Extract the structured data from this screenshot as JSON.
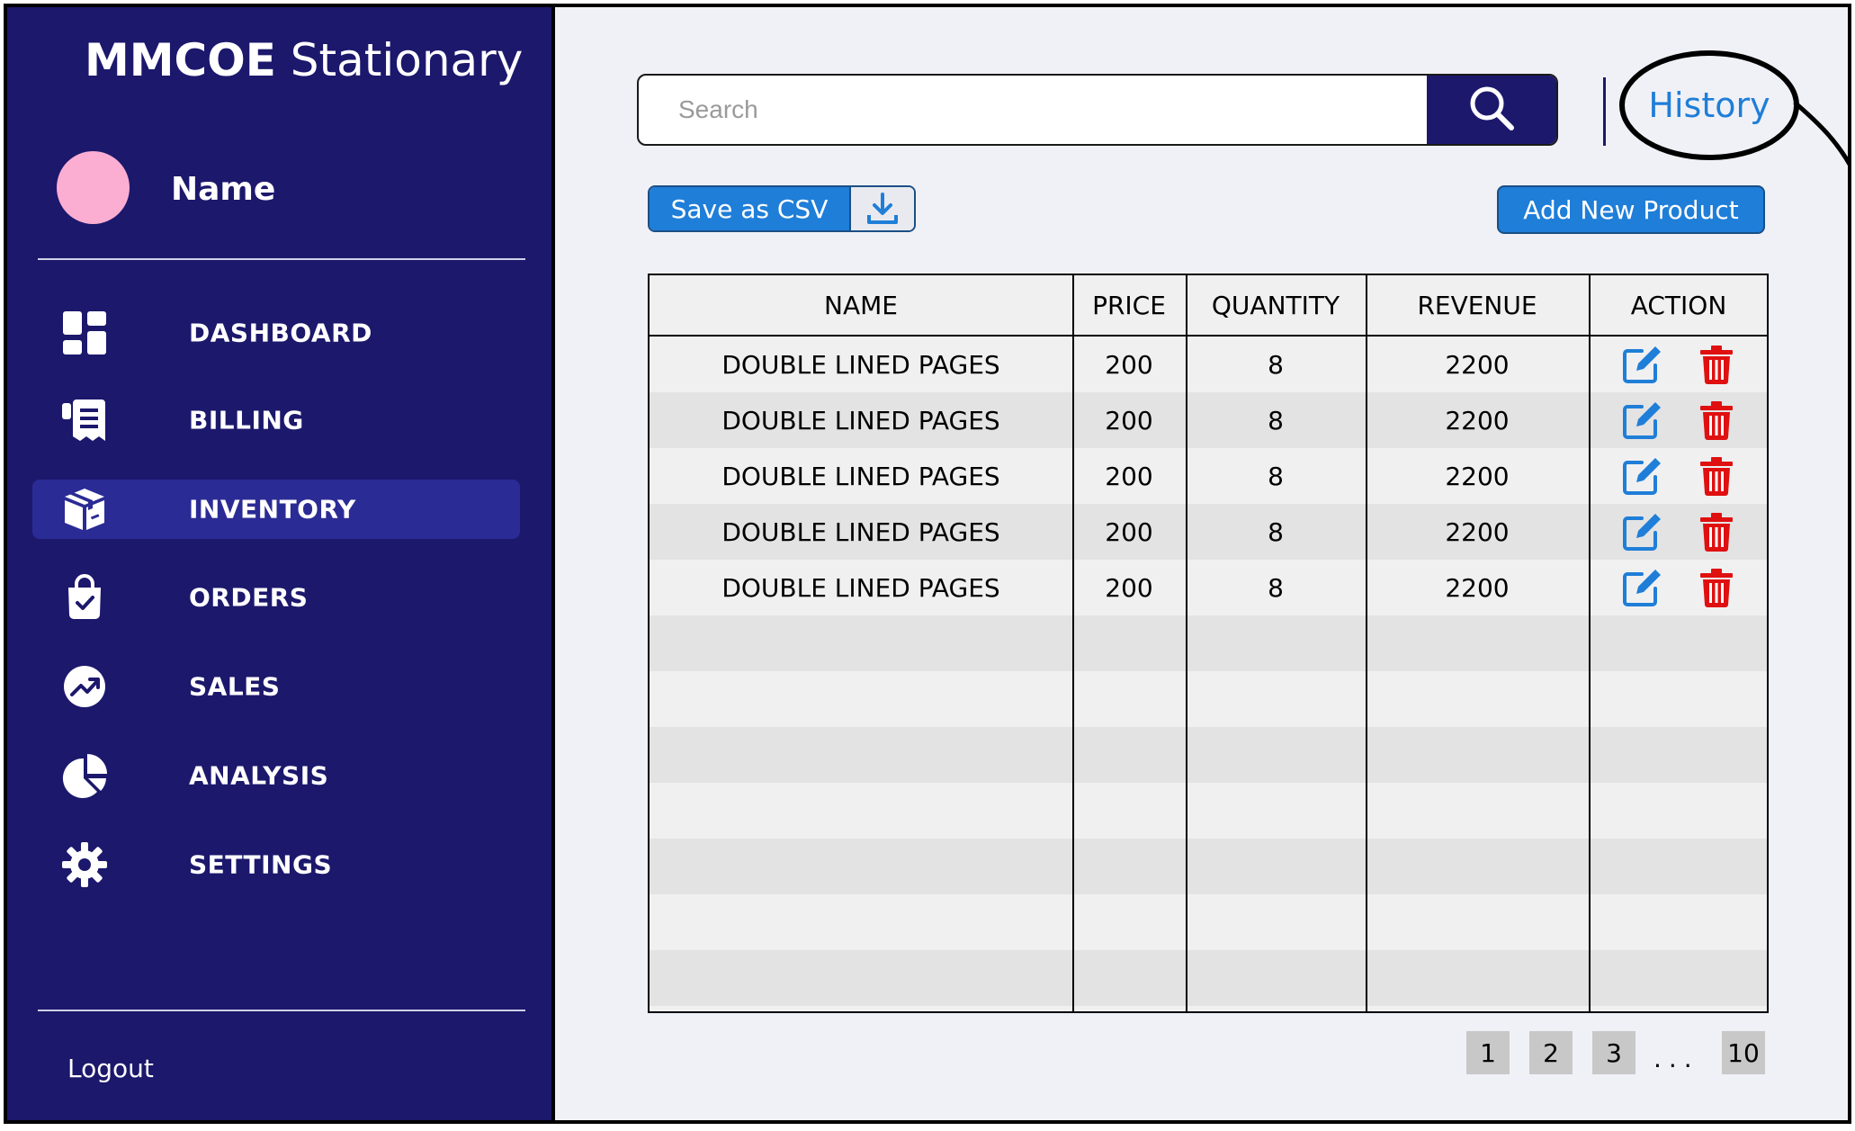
{
  "brand": {
    "bold": "MMCOE",
    "rest": " Stationary"
  },
  "user": {
    "name": "Name"
  },
  "nav": {
    "items": [
      {
        "label": "DASHBOARD",
        "icon": "dashboard-icon",
        "active": false
      },
      {
        "label": "BILLING",
        "icon": "receipt-icon",
        "active": false
      },
      {
        "label": "INVENTORY",
        "icon": "box-icon",
        "active": true
      },
      {
        "label": "ORDERS",
        "icon": "shopping-bag-icon",
        "active": false
      },
      {
        "label": "SALES",
        "icon": "trend-up-icon",
        "active": false
      },
      {
        "label": "ANALYSIS",
        "icon": "pie-chart-icon",
        "active": false
      },
      {
        "label": "SETTINGS",
        "icon": "gear-icon",
        "active": false
      }
    ],
    "logout": "Logout"
  },
  "search": {
    "placeholder": "Search",
    "value": ""
  },
  "history": {
    "label": "History"
  },
  "actions": {
    "save_csv": "Save as CSV",
    "add_product": "Add New Product"
  },
  "table": {
    "columns": [
      "NAME",
      "PRICE",
      "QUANTITY",
      "REVENUE",
      "ACTION"
    ],
    "rows": [
      {
        "name": "DOUBLE LINED PAGES",
        "price": "200",
        "quantity": "8",
        "revenue": "2200"
      },
      {
        "name": "DOUBLE LINED PAGES",
        "price": "200",
        "quantity": "8",
        "revenue": "2200"
      },
      {
        "name": "DOUBLE LINED PAGES",
        "price": "200",
        "quantity": "8",
        "revenue": "2200"
      },
      {
        "name": "DOUBLE LINED PAGES",
        "price": "200",
        "quantity": "8",
        "revenue": "2200"
      },
      {
        "name": "DOUBLE LINED PAGES",
        "price": "200",
        "quantity": "8",
        "revenue": "2200"
      }
    ],
    "empty_rows": 7
  },
  "pagination": {
    "pages": [
      "1",
      "2",
      "3"
    ],
    "dots": "...",
    "last": "10"
  },
  "colors": {
    "sidebar": "#1c186c",
    "sidebar_active": "#2b2b96",
    "accent": "#1f7ed8",
    "delete": "#e01010",
    "avatar": "#fbaed2"
  }
}
